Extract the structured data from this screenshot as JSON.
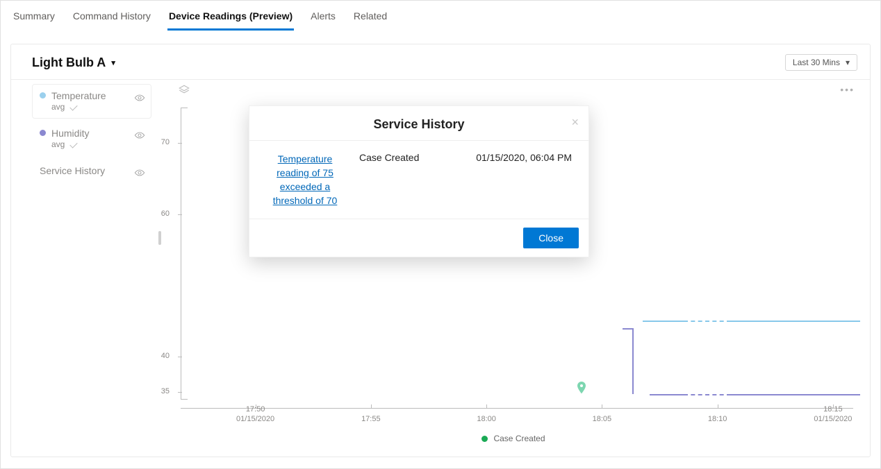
{
  "tabs": [
    {
      "label": "Summary",
      "active": false
    },
    {
      "label": "Command History",
      "active": false
    },
    {
      "label": "Device Readings (Preview)",
      "active": true
    },
    {
      "label": "Alerts",
      "active": false
    },
    {
      "label": "Related",
      "active": false
    }
  ],
  "device_title": "Light Bulb A",
  "time_range_label": "Last 30 Mins",
  "legend": {
    "items": [
      {
        "name": "Temperature",
        "sub": "avg",
        "color": "#9bd0ed"
      },
      {
        "name": "Humidity",
        "sub": "avg",
        "color": "#8a88d0"
      },
      {
        "name": "Service History",
        "sub": "",
        "color": ""
      }
    ]
  },
  "footer_marker_label": "Case Created",
  "modal": {
    "title": "Service History",
    "link_text": "Temperature reading of 75 exceeded a threshold of 70",
    "status": "Case Created",
    "timestamp": "01/15/2020, 06:04 PM",
    "close_button": "Close"
  },
  "chart_data": {
    "type": "line",
    "xlabel": "",
    "ylabel": "",
    "x_ticks": [
      {
        "label": "17:50",
        "sub": "01/15/2020",
        "pos": 0.11
      },
      {
        "label": "17:55",
        "sub": "",
        "pos": 0.28
      },
      {
        "label": "18:00",
        "sub": "",
        "pos": 0.45
      },
      {
        "label": "18:05",
        "sub": "",
        "pos": 0.62
      },
      {
        "label": "18:10",
        "sub": "",
        "pos": 0.79
      },
      {
        "label": "18:15",
        "sub": "01/15/2020",
        "pos": 0.96
      }
    ],
    "y_ticks": [
      {
        "label": "70",
        "val": 70
      },
      {
        "label": "60",
        "val": 60
      },
      {
        "label": "40",
        "val": 40
      },
      {
        "label": "35",
        "val": 35
      }
    ],
    "ylim": [
      34,
      75
    ],
    "series": [
      {
        "name": "Temperature",
        "color": "#87c8ea",
        "segments": [
          {
            "from_x": 0.68,
            "to_x": 0.74,
            "y": 45,
            "dashed": false
          },
          {
            "from_x": 0.74,
            "to_x": 0.81,
            "y": 45,
            "dashed": true
          },
          {
            "from_x": 0.81,
            "to_x": 1.0,
            "y": 45,
            "dashed": false
          }
        ]
      },
      {
        "name": "Humidity",
        "color": "#8a88d0",
        "segments": [
          {
            "from_x": 0.665,
            "to_x": 0.69,
            "y_from": 44,
            "y_to": 34.7,
            "drop": true
          },
          {
            "from_x": 0.69,
            "to_x": 0.74,
            "y": 34.7,
            "dashed": false
          },
          {
            "from_x": 0.74,
            "to_x": 0.81,
            "y": 34.7,
            "dashed": true
          },
          {
            "from_x": 0.81,
            "to_x": 1.0,
            "y": 34.7,
            "dashed": false
          }
        ]
      }
    ],
    "event_marker": {
      "x": 0.59,
      "label": "Case Created",
      "color": "#7dd6b0"
    }
  }
}
